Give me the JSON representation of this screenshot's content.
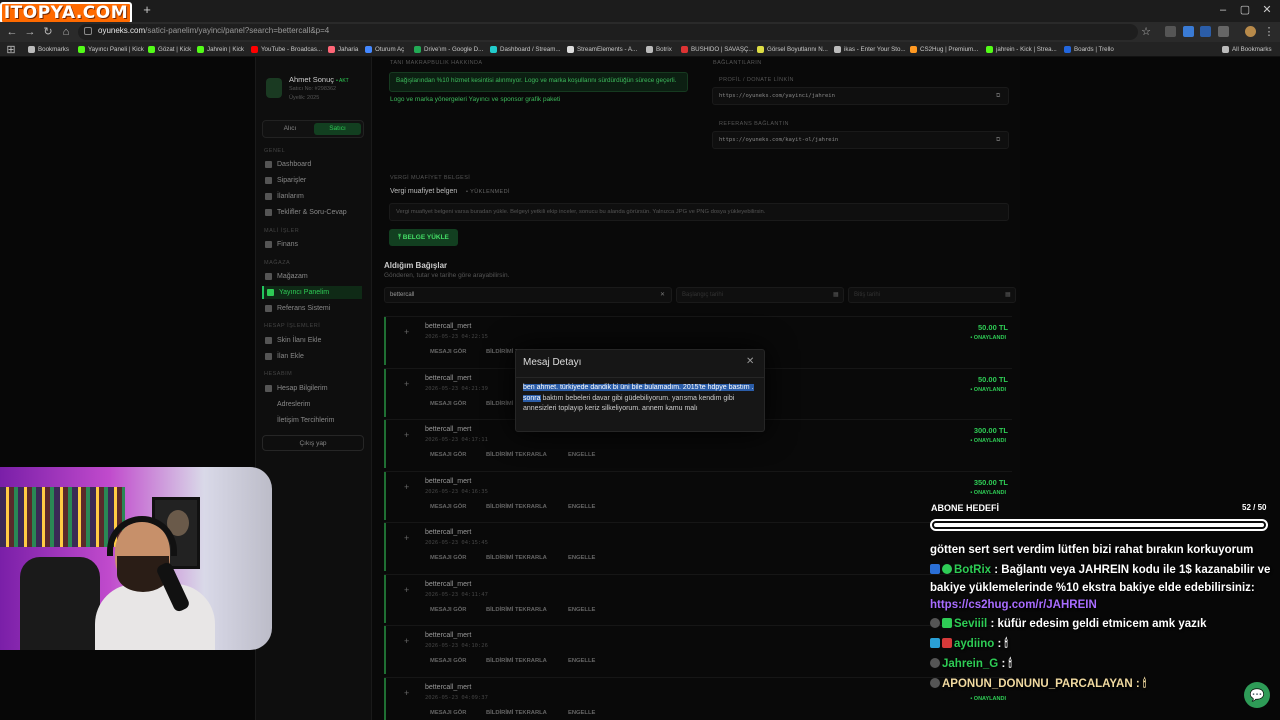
{
  "logo": {
    "text": "ITOPYA.COM"
  },
  "browser": {
    "url_domain": "oyuneks.com",
    "url_path": "/satici-panelim/yayinci/panel?search=bettercall&p=4",
    "new_tab": "+",
    "window_controls": [
      "–",
      "▢",
      "✕"
    ]
  },
  "bookmarks": [
    {
      "label": "Bookmarks",
      "color": "#bbbbbb"
    },
    {
      "label": "Yayıncı Paneli | Kick",
      "color": "#53fc18"
    },
    {
      "label": "Gözat | Kick",
      "color": "#53fc18"
    },
    {
      "label": "Jahrein | Kick",
      "color": "#53fc18"
    },
    {
      "label": "YouTube - Broadcas...",
      "color": "#ff0000"
    },
    {
      "label": "Jaharia",
      "color": "#ff6677"
    },
    {
      "label": "Oturum Aç",
      "color": "#4488ff"
    },
    {
      "label": "Drive'ım - Google D...",
      "color": "#22aa55"
    },
    {
      "label": "Dashboard / Stream...",
      "color": "#22cccc"
    },
    {
      "label": "StreamElements - A...",
      "color": "#dddddd"
    },
    {
      "label": "Botrix",
      "color": "#bbbbbb"
    },
    {
      "label": "BUSHIDO | SAVAŞÇ...",
      "color": "#dd3333"
    },
    {
      "label": "Görsel Boyutlarını N...",
      "color": "#dddd44"
    },
    {
      "label": "ikas - Enter Your Sto...",
      "color": "#bbbbbb"
    },
    {
      "label": "CS2Hug | Premium...",
      "color": "#ff9922"
    },
    {
      "label": "jahrein - Kick | Strea...",
      "color": "#53fc18"
    },
    {
      "label": "Boards | Trello",
      "color": "#2266dd"
    },
    {
      "label": "All Bookmarks",
      "color": "#bbbbbb"
    }
  ],
  "profile": {
    "name": "Ahmet Sonuç",
    "badge": "• AKT",
    "line1": "Satıcı No: #298362",
    "line2": "Üyelik: 2025"
  },
  "toggle": {
    "buyer": "Alıcı",
    "seller": "Satıcı"
  },
  "sidebar": {
    "sec_general": "GENEL",
    "sec_finance": "MALİ İŞLER",
    "sec_store": "MAĞAZA",
    "sec_account_ops": "HESAP İŞLEMLERİ",
    "sec_account": "HESABIM",
    "items": [
      {
        "label": "Dashboard"
      },
      {
        "label": "Siparişler"
      },
      {
        "label": "İlanlarım"
      },
      {
        "label": "Teklifler & Soru-Cevap"
      },
      {
        "label": "Finans"
      },
      {
        "label": "Mağazam"
      },
      {
        "label": "Yayıncı Panelim"
      },
      {
        "label": "Referans Sistemi"
      },
      {
        "label": "Skin İlanı Ekle"
      },
      {
        "label": "İlan Ekle"
      },
      {
        "label": "Hesap Bilgilerim"
      },
      {
        "label": "Adreslerim"
      },
      {
        "label": "İletişim Tercihlerim"
      }
    ],
    "logout": "Çıkış yap"
  },
  "main": {
    "sponsor_heading": "TANI MAKRAPBULIK HAKKINDA",
    "sponsor_note": "Bağışlarından %10 hizmet kesintisi alınmıyor. Logo ve marka koşullarını sürdürdüğün sürece geçerli.",
    "sponsor_links": "Logo ve marka yönergeleri   Yayıncı ve sponsor grafik paketi",
    "links_heading": "BAĞLANTILARIN",
    "profile_link_label": "PROFİL / DONATE LİNKİN",
    "profile_link": "https://oyuneks.com/yayinci/jahrein",
    "ref_link_label": "REFERANS BAĞLANTIN",
    "ref_link": "https://oyuneks.com/kayit-ol/jahrein",
    "tax_heading": "VERGİ MUAFİYET BELGESİ",
    "tax_title": "Vergi muafiyet belgen",
    "tax_status": "• YÜKLENMEDİ",
    "tax_desc": "Vergi muafiyet belgeni varsa buradan yükle. Belgeyi yetkili ekip inceler, sonucu bu alanda görürsün. Yalnızca JPG ve PNG dosya yükleyebilirsin.",
    "upload_btn": "⤒  BELGE YÜKLE",
    "donations_title": "Aldığım Bağışlar",
    "donations_sub": "Gönderen, tutar ve tarihe göre arayabilirsin.",
    "filter_search": "bettercall",
    "filter_start": "Başlangıç tarihi",
    "filter_end": "Bitiş tarihi",
    "action_msg": "MESAJI GÖR",
    "action_resend": "BİLDİRİMİ TEKRARLA",
    "action_block": "ENGELLE",
    "rows": [
      {
        "name": "bettercall_mert",
        "date": "2026-05-23 04:22:15",
        "amount": "50.00 TL",
        "status": "• ONAYLANDI"
      },
      {
        "name": "bettercall_mert",
        "date": "2026-05-23 04:21:39",
        "amount": "50.00 TL",
        "status": "• ONAYLANDI"
      },
      {
        "name": "bettercall_mert",
        "date": "2026-05-23 04:17:11",
        "amount": "300.00 TL",
        "status": "• ONAYLANDI"
      },
      {
        "name": "bettercall_mert",
        "date": "2026-05-23 04:16:35",
        "amount": "350.00 TL",
        "status": "• ONAYLANDI"
      },
      {
        "name": "bettercall_mert",
        "date": "2026-05-23 04:15:45",
        "amount": "",
        "status": ""
      },
      {
        "name": "bettercall_mert",
        "date": "2026-05-23 04:11:47",
        "amount": "",
        "status": ""
      },
      {
        "name": "bettercall_mert",
        "date": "2026-05-23 04:10:26",
        "amount": "",
        "status": ""
      },
      {
        "name": "bettercall_mert",
        "date": "2026-05-23 04:09:37",
        "amount": "",
        "status": "• ONAYLANDI"
      }
    ]
  },
  "modal": {
    "title": "Mesaj Detayı",
    "close": "✕",
    "msg_selected": "ben ahmet. türkiyede dandik bi üni bile bulamadım. 2015'te hdpye bastım . sonra",
    "msg_rest": " baktım bebeleri davar gibi güdebiliyorum. yarısma kendim gibi annesizleri toplayıp keriz silkeliyorum. annem kamu malı"
  },
  "overlay": {
    "goal_title": "ABONE HEDEFİ",
    "goal_count": "52 / 50",
    "goal_progress": 1.0,
    "chat": [
      {
        "user": "",
        "text": "götten sert sert verdim lütfen bizi rahat bırakın korkuyorum"
      },
      {
        "user": "BotRix",
        "text": ": Bağlantı veya JAHREIN kodu ile 1$ kazanabilir ve bakiye yüklemelerinde %10 ekstra bakiye elde edebilirsiniz:",
        "link": "https://cs2hug.com/r/JAHREIN"
      },
      {
        "user": "Seviiil",
        "text": ": küfür edesim geldi etmicem amk yazık"
      },
      {
        "user": "aydiino",
        "text": ": 🕯"
      },
      {
        "user": "Jahrein_G",
        "text": ": 🕯"
      },
      {
        "user": "APONUN_DONUNU_PARCALAYAN",
        "text": ": 🕯"
      }
    ],
    "chat_icon": "💬"
  }
}
